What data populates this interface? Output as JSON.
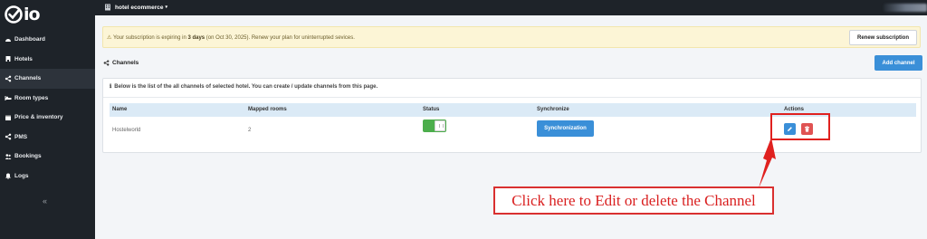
{
  "brand": {
    "name": "io"
  },
  "sidebar": {
    "items": [
      {
        "label": "Dashboard",
        "icon": "dashboard-icon"
      },
      {
        "label": "Hotels",
        "icon": "hotel-icon"
      },
      {
        "label": "Channels",
        "icon": "share-icon"
      },
      {
        "label": "Room types",
        "icon": "bed-icon"
      },
      {
        "label": "Price & inventory",
        "icon": "calendar-icon"
      },
      {
        "label": "PMS",
        "icon": "share-icon"
      },
      {
        "label": "Bookings",
        "icon": "users-icon"
      },
      {
        "label": "Logs",
        "icon": "bell-icon"
      }
    ],
    "active": "Channels",
    "collapse_label": "«"
  },
  "topbar": {
    "hotel_name": "hotel ecommerce",
    "caret": "▾"
  },
  "alert": {
    "prefix": "Your subscription is expiring in ",
    "days": "3 days",
    "suffix": " (on Oct 30, 2025). Renew your plan for uninterrupted sevices.",
    "button": "Renew subscription",
    "warning_icon": "⚠"
  },
  "page": {
    "title": "Channels",
    "add_button": "Add channel"
  },
  "panel": {
    "info_icon": "ℹ",
    "info": "Below is the list of the all channels of selected hotel. You can create / update channels from this page."
  },
  "table": {
    "headers": {
      "name": "Name",
      "mapped": "Mapped rooms",
      "status": "Status",
      "sync": "Synchronize",
      "actions": "Actions"
    },
    "rows": [
      {
        "name": "Hostelworld",
        "mapped": "2",
        "status_on": true,
        "sync_label": "Synchronization"
      }
    ]
  },
  "annotation": {
    "callout": "Click here to Edit or delete the Channel",
    "color": "#d91f1f"
  },
  "colors": {
    "primary": "#3a8fd8",
    "danger": "#e05353",
    "success": "#4cae4c",
    "sidebar": "#1e2329"
  }
}
